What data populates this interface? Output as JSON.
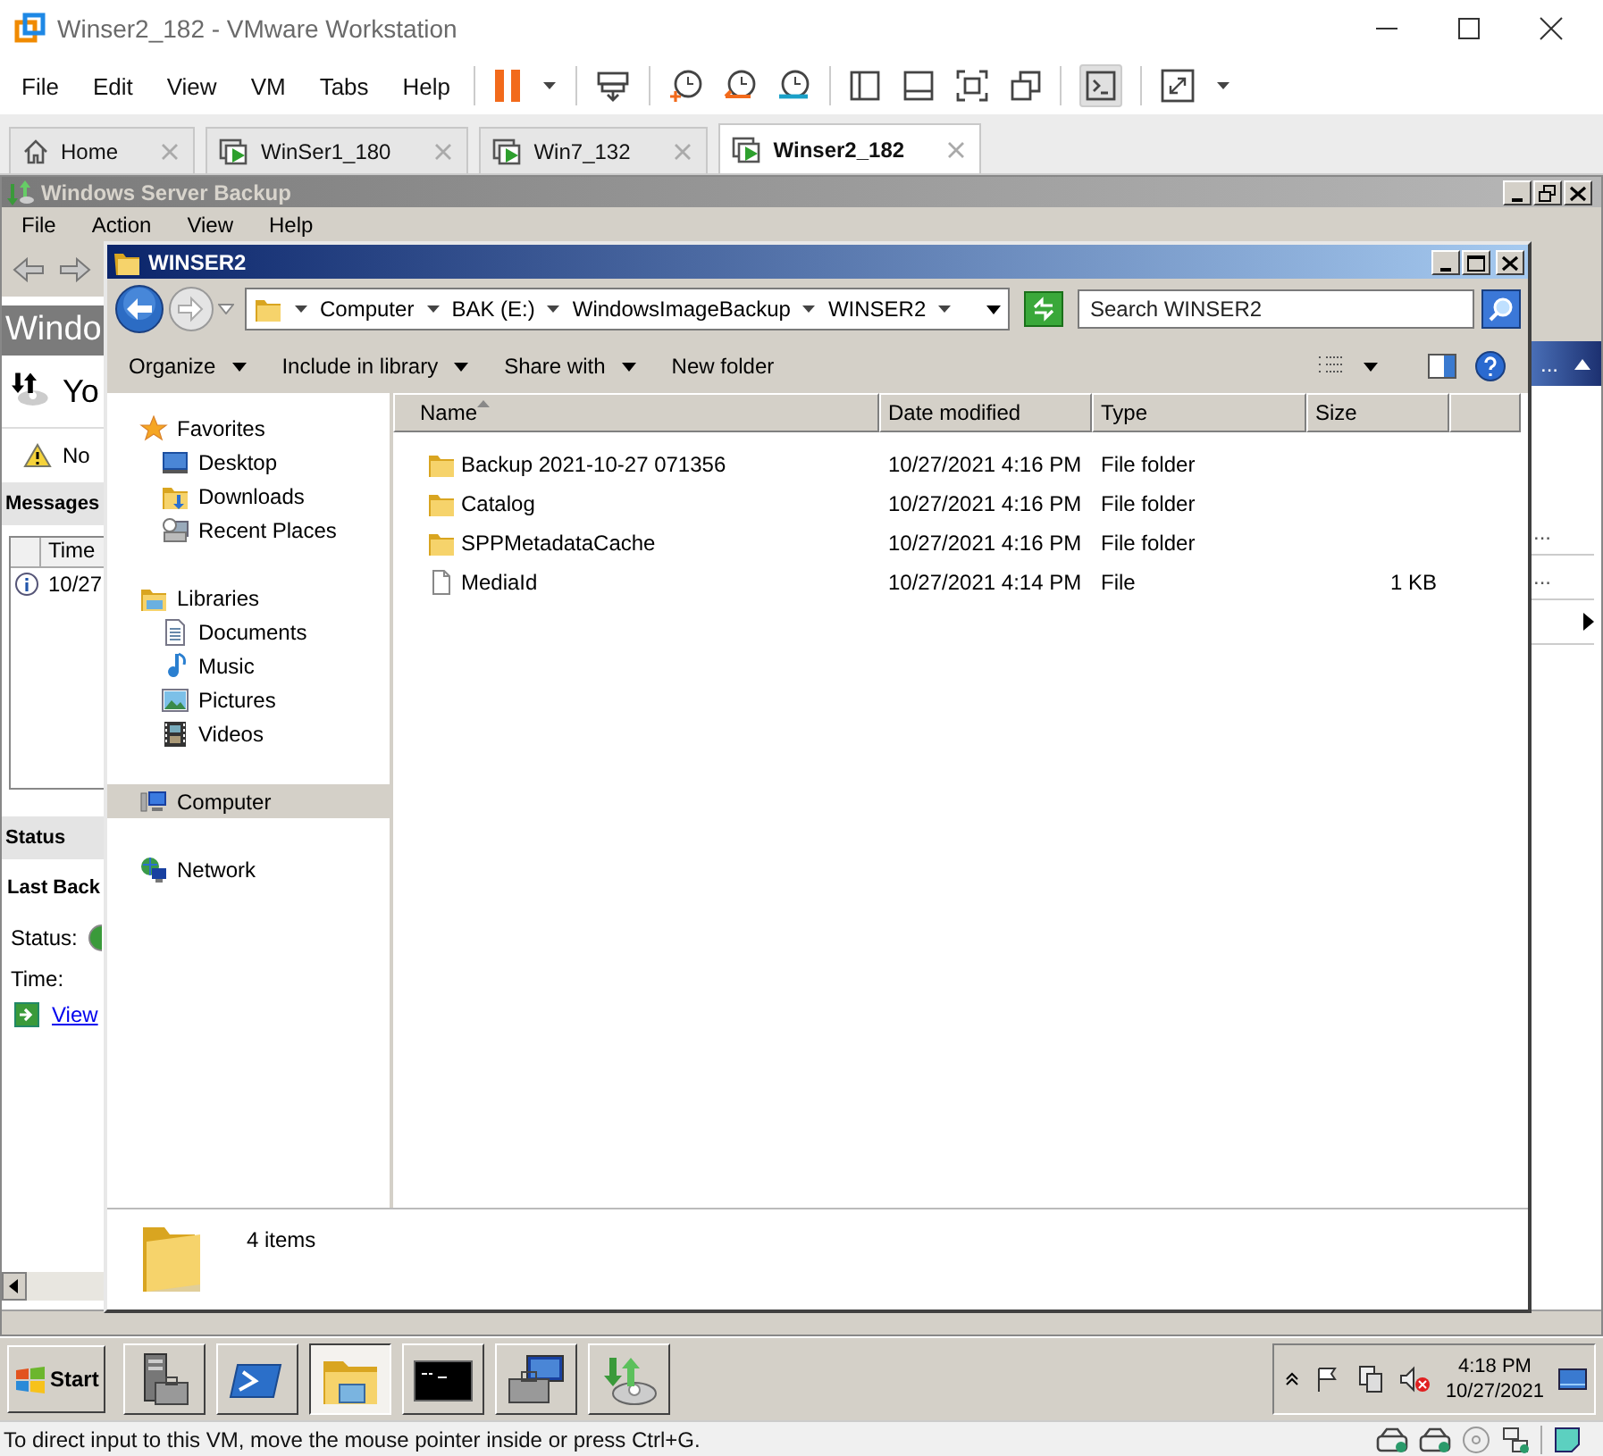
{
  "vmware": {
    "title": "Winser2_182 - VMware Workstation",
    "menu": [
      "File",
      "Edit",
      "View",
      "VM",
      "Tabs",
      "Help"
    ],
    "tabs": [
      {
        "label": "Home",
        "kind": "home",
        "selected": false
      },
      {
        "label": "WinSer1_180",
        "kind": "vm",
        "selected": false
      },
      {
        "label": "Win7_132",
        "kind": "vm",
        "selected": false
      },
      {
        "label": "Winser2_182",
        "kind": "vm",
        "selected": true
      }
    ],
    "status_text": "To direct input to this VM, move the mouse pointer inside or press Ctrl+G."
  },
  "backup_window": {
    "title": "Windows Server Backup",
    "menu": [
      "File",
      "Action",
      "View",
      "Help"
    ],
    "header": "Windo",
    "summary": "Yo",
    "warning": "No",
    "messages_heading": "Messages",
    "messages_column": "Time",
    "message_time": "10/27",
    "status_heading": "Status",
    "last_backup_heading": "Last Back",
    "status_label": "Status:",
    "time_label": "Time:",
    "link": "View",
    "actions_header": "...",
    "actions": [
      "...",
      "..."
    ]
  },
  "explorer": {
    "title": "WINSER2",
    "breadcrumb": [
      "Computer",
      "BAK (E:)",
      "WindowsImageBackup",
      "WINSER2"
    ],
    "search": {
      "placeholder": "Search WINSER2"
    },
    "toolbar": [
      {
        "label": "Organize",
        "dropdown": true
      },
      {
        "label": "Include in library",
        "dropdown": true
      },
      {
        "label": "Share with",
        "dropdown": true
      },
      {
        "label": "New folder",
        "dropdown": false
      }
    ],
    "nav": [
      {
        "label": "Favorites",
        "kind": "favorites",
        "selected": false,
        "children": [
          {
            "label": "Desktop",
            "kind": "desktop",
            "selected": false
          },
          {
            "label": "Downloads",
            "kind": "downloads",
            "selected": false
          },
          {
            "label": "Recent Places",
            "kind": "recent",
            "selected": false
          }
        ]
      },
      {
        "label": "Libraries",
        "kind": "libraries",
        "selected": false,
        "children": [
          {
            "label": "Documents",
            "kind": "documents",
            "selected": false
          },
          {
            "label": "Music",
            "kind": "music",
            "selected": false
          },
          {
            "label": "Pictures",
            "kind": "pictures",
            "selected": false
          },
          {
            "label": "Videos",
            "kind": "videos",
            "selected": false
          }
        ]
      },
      {
        "label": "Computer",
        "kind": "computer",
        "selected": true
      },
      {
        "label": "Network",
        "kind": "network",
        "selected": false
      }
    ],
    "columns": [
      {
        "label": "Name",
        "sorted": true
      },
      {
        "label": "Date modified",
        "sorted": false
      },
      {
        "label": "Type",
        "sorted": false
      },
      {
        "label": "Size",
        "sorted": false
      }
    ],
    "rows": [
      {
        "kind": "folder",
        "name": "Backup 2021-10-27 071356",
        "date": "10/27/2021 4:16 PM",
        "type": "File folder"
      },
      {
        "kind": "folder",
        "name": "Catalog",
        "date": "10/27/2021 4:16 PM",
        "type": "File folder"
      },
      {
        "kind": "folder",
        "name": "SPPMetadataCache",
        "date": "10/27/2021 4:16 PM",
        "type": "File folder"
      },
      {
        "kind": "file",
        "name": "MediaId",
        "date": "10/27/2021 4:14 PM",
        "type": "File",
        "size": "1 KB"
      }
    ],
    "item_count": "4 items"
  },
  "taskbar": {
    "start": "Start",
    "apps": [
      {
        "kind": "server-manager",
        "selected": false
      },
      {
        "kind": "powershell",
        "selected": false
      },
      {
        "kind": "explorer",
        "selected": true
      },
      {
        "kind": "cmd",
        "selected": false
      },
      {
        "kind": "server-tool",
        "selected": false
      },
      {
        "kind": "backup",
        "selected": false
      }
    ],
    "time": "4:18 PM",
    "date": "10/27/2021"
  }
}
